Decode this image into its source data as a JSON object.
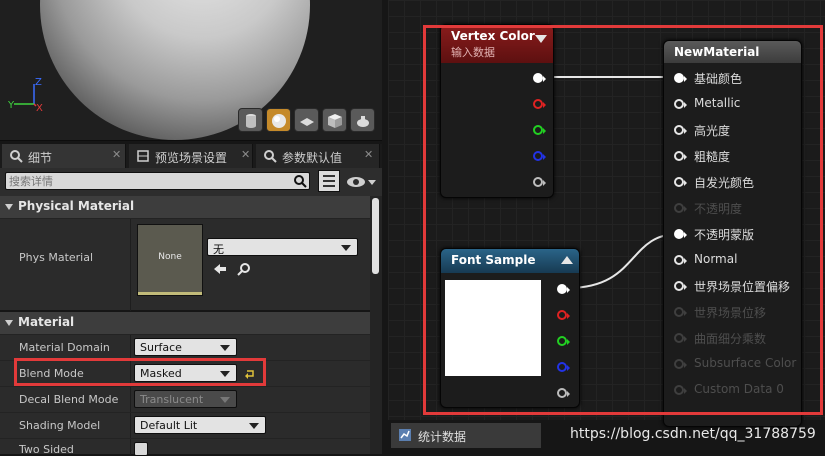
{
  "tabs": [
    {
      "label": "细节",
      "active": true
    },
    {
      "label": "预览场景设置",
      "active": false
    },
    {
      "label": "参数默认值",
      "active": false
    }
  ],
  "search": {
    "placeholder": "搜索详情"
  },
  "physical_material": {
    "title": "Physical Material",
    "phys_label": "Phys Material",
    "thumb_text": "None",
    "dropdown_value": "无"
  },
  "material": {
    "title": "Material",
    "rows": [
      {
        "label": "Material Domain",
        "value": "Surface",
        "enabled": true
      },
      {
        "label": "Blend Mode",
        "value": "Masked",
        "enabled": true
      },
      {
        "label": "Decal Blend Mode",
        "value": "Translucent",
        "enabled": false
      },
      {
        "label": "Shading Model",
        "value": "Default Lit",
        "enabled": true
      },
      {
        "label": "Two Sided",
        "value": "",
        "enabled": true
      }
    ]
  },
  "viewport_axes": {
    "z": "Z",
    "y": "Y",
    "x": "X"
  },
  "vertex_color": {
    "title": "Vertex Color",
    "subtitle": "输入数据"
  },
  "font_sample": {
    "title": "Font Sample"
  },
  "new_material": {
    "title": "NewMaterial",
    "inputs": [
      {
        "label": "基础颜色",
        "connected": true,
        "enabled": true
      },
      {
        "label": "Metallic",
        "connected": false,
        "enabled": true
      },
      {
        "label": "高光度",
        "connected": false,
        "enabled": true
      },
      {
        "label": "粗糙度",
        "connected": false,
        "enabled": true
      },
      {
        "label": "自发光颜色",
        "connected": false,
        "enabled": true
      },
      {
        "label": "不透明度",
        "connected": false,
        "enabled": false
      },
      {
        "label": "不透明蒙版",
        "connected": true,
        "enabled": true
      },
      {
        "label": "Normal",
        "connected": false,
        "enabled": true
      },
      {
        "label": "世界场景位置偏移",
        "connected": false,
        "enabled": true
      },
      {
        "label": "世界场景位移",
        "connected": false,
        "enabled": false
      },
      {
        "label": "曲面细分乘数",
        "connected": false,
        "enabled": false
      },
      {
        "label": "Subsurface Color",
        "connected": false,
        "enabled": false
      },
      {
        "label": "Custom Data 0",
        "connected": false,
        "enabled": false
      }
    ]
  },
  "bottom_tab": {
    "label": "统计数据"
  },
  "watermark": "https://blog.csdn.net/qq_31788759",
  "colors": {
    "highlight_box": "#e23a3a",
    "vertex_header": "#8a1c1c",
    "font_header": "#1f4a66",
    "result_header": "#4a4a4a"
  }
}
